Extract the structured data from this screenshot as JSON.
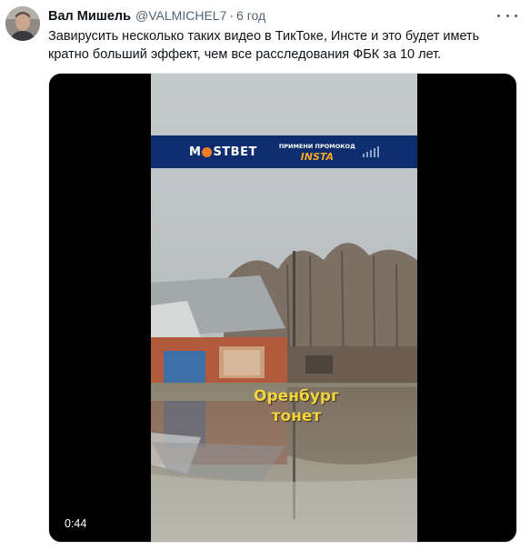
{
  "tweet": {
    "author_name": "Вал Мишель",
    "handle": "@VALMICHEL7",
    "separator": "·",
    "time": "6 год",
    "text": "Завирусить несколько таких видео в ТикТоке, Инсте и это будет иметь кратно больший эффект, чем все расследования ФБК за 10 лет."
  },
  "video": {
    "duration": "0:44",
    "caption_line1": "Оренбург",
    "caption_line2": "тонет",
    "ad_logo": "M",
    "ad_logo_rest": "STBET",
    "ad_promo_line1": "ПРИМЕНИ ПРОМОКОД",
    "ad_promo_code": "INSTA"
  },
  "colors": {
    "caption": "#f5d33a",
    "banner_bg": "#0d2d6e",
    "promo_code": "#f5a623",
    "logo_accent": "#f27d22"
  },
  "icons": {
    "more": "more-horizontal-icon",
    "avatar": "user-avatar"
  }
}
